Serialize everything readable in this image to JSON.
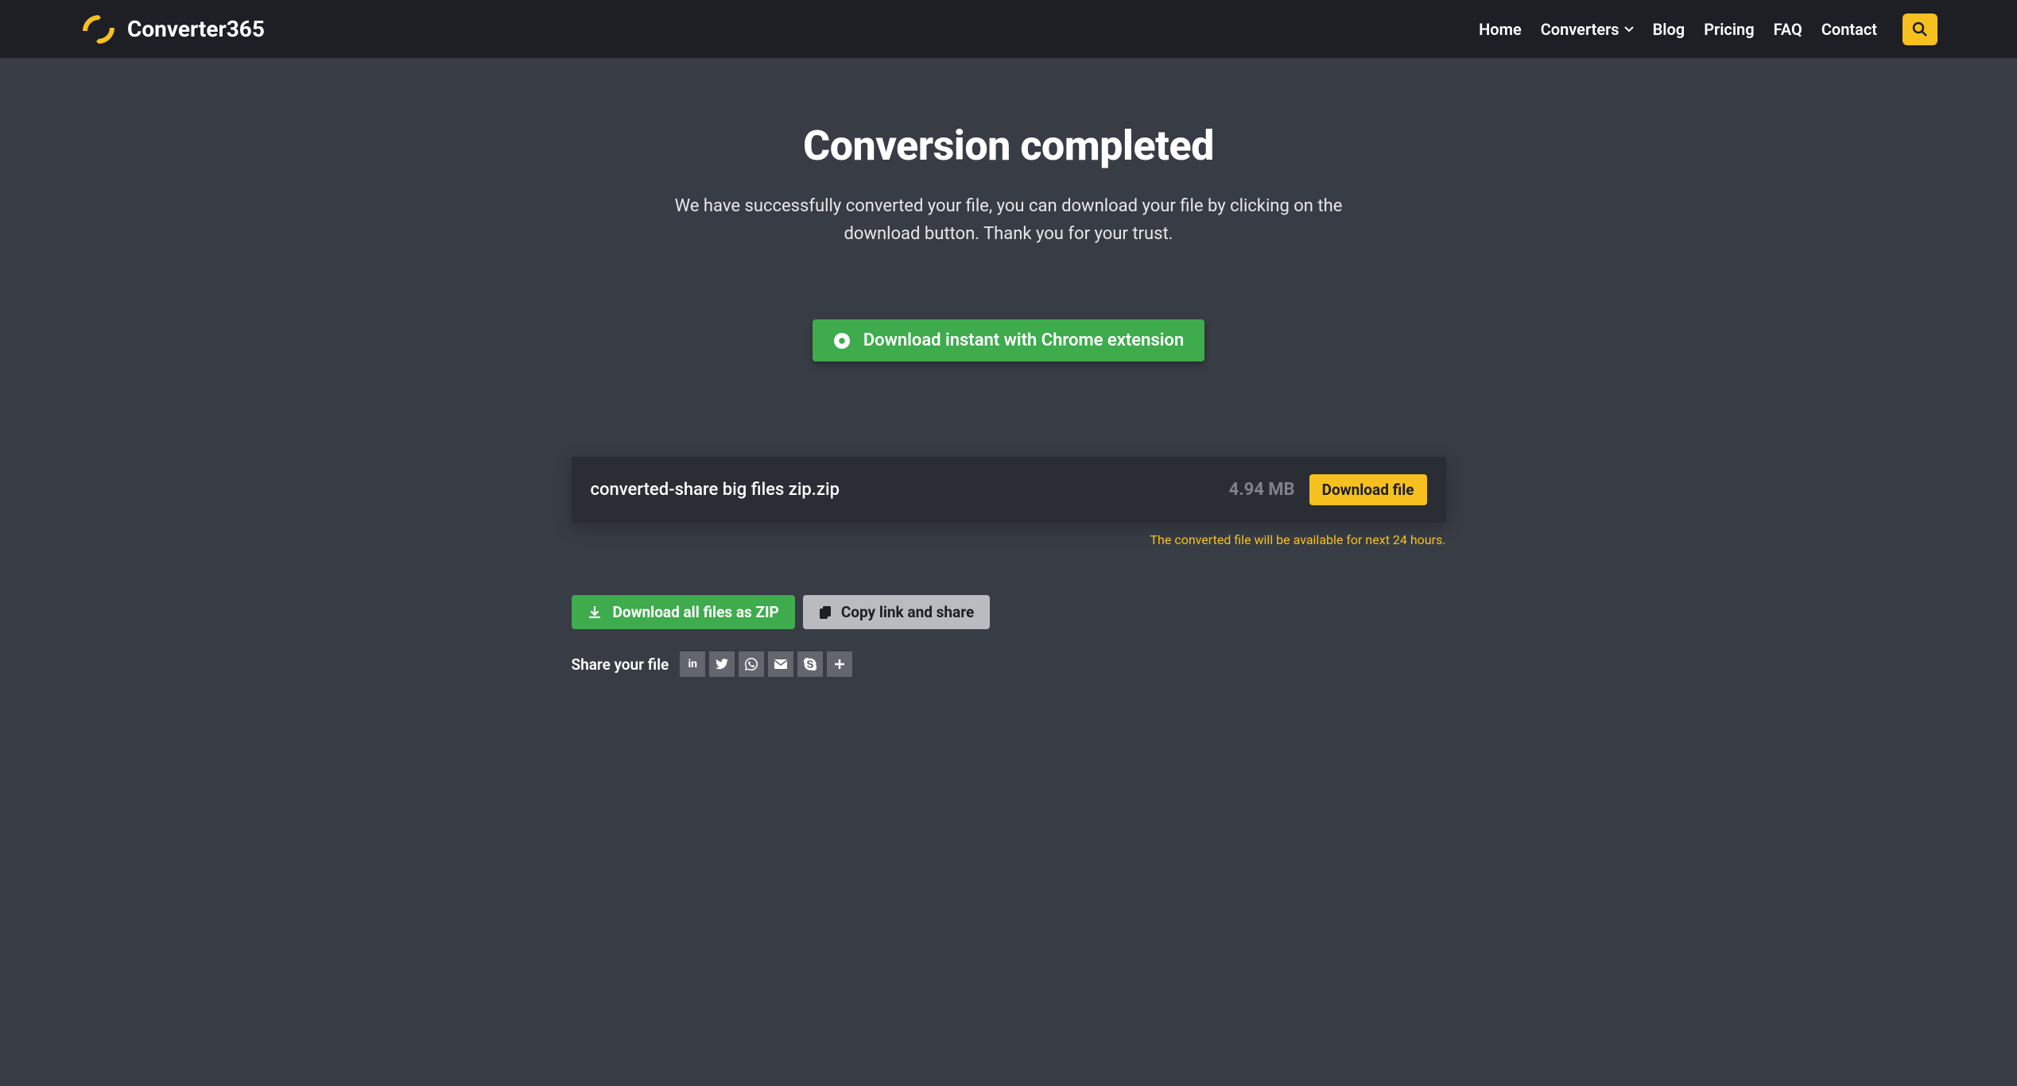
{
  "header": {
    "brand": "Converter365",
    "nav": {
      "home": "Home",
      "converters": "Converters",
      "blog": "Blog",
      "pricing": "Pricing",
      "faq": "FAQ",
      "contact": "Contact"
    }
  },
  "main": {
    "title": "Conversion completed",
    "subtitle": "We have successfully converted your file, you can download your file by clicking on the download button. Thank you for your trust.",
    "chrome_btn": "Download instant with Chrome extension"
  },
  "file": {
    "name": "converted-share big files zip.zip",
    "size": "4.94 MB",
    "download_label": "Download file"
  },
  "notice": "The converted file will be available for next 24 hours.",
  "actions": {
    "zip": "Download all files as ZIP",
    "copy": "Copy link and share"
  },
  "share": {
    "label": "Share your file"
  }
}
